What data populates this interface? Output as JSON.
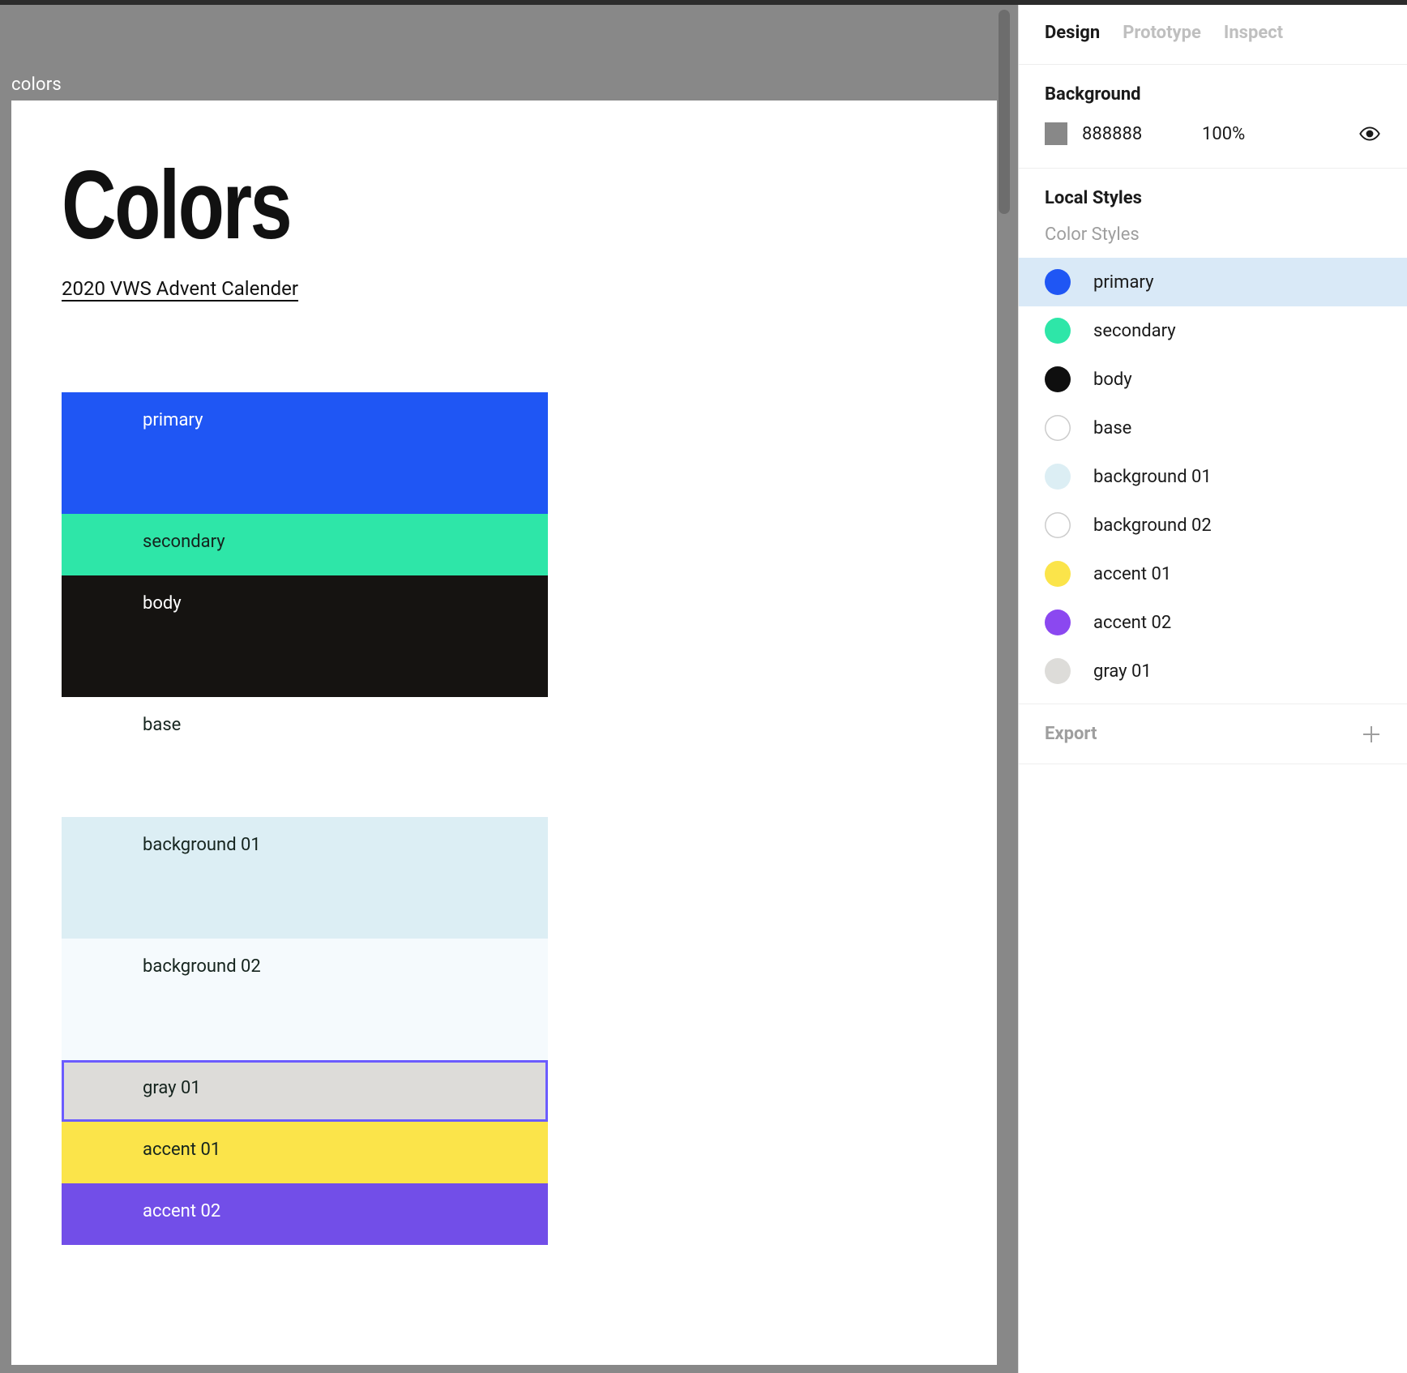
{
  "canvas": {
    "frame_label": "colors",
    "page_title": "Colors",
    "page_subtitle": "2020 VWS Advent Calender",
    "swatches": [
      {
        "label": "primary",
        "bg": "#1f56f4",
        "fg": "#ffffff",
        "size": "h-lg",
        "selected": false
      },
      {
        "label": "secondary",
        "bg": "#2ee6a8",
        "fg": "#15241e",
        "size": "h-md",
        "selected": false
      },
      {
        "label": "body",
        "bg": "#151311",
        "fg": "#ffffff",
        "size": "h-lg",
        "selected": false
      },
      {
        "label": "base",
        "bg": "#ffffff",
        "fg": "#15241e",
        "size": "h-md",
        "selected": false,
        "gap_after": true
      },
      {
        "label": "background 01",
        "bg": "#dceef4",
        "fg": "#15241e",
        "size": "h-bg",
        "selected": false
      },
      {
        "label": "background 02",
        "bg": "#f5fafd",
        "fg": "#15241e",
        "size": "h-bg",
        "selected": false
      },
      {
        "label": "gray 01",
        "bg": "#dddcd9",
        "fg": "#15241e",
        "size": "h-md",
        "selected": true
      },
      {
        "label": "accent 01",
        "bg": "#fbe44a",
        "fg": "#15241e",
        "size": "h-md",
        "selected": false
      },
      {
        "label": "accent 02",
        "bg": "#724ee8",
        "fg": "#ffffff",
        "size": "h-md",
        "selected": false
      }
    ]
  },
  "panel": {
    "tabs": [
      {
        "label": "Design",
        "active": true
      },
      {
        "label": "Prototype",
        "active": false
      },
      {
        "label": "Inspect",
        "active": false
      }
    ],
    "background": {
      "title": "Background",
      "hex": "888888",
      "opacity": "100%",
      "chip_color": "#888888"
    },
    "local_styles": {
      "title": "Local Styles",
      "sub": "Color Styles",
      "items": [
        {
          "label": "primary",
          "color": "#1f56f4",
          "outline": false,
          "selected": true
        },
        {
          "label": "secondary",
          "color": "#2ee6a8",
          "outline": false,
          "selected": false
        },
        {
          "label": "body",
          "color": "#0f0f0f",
          "outline": false,
          "selected": false
        },
        {
          "label": "base",
          "color": "#ffffff",
          "outline": true,
          "selected": false
        },
        {
          "label": "background 01",
          "color": "#dceef4",
          "outline": false,
          "selected": false
        },
        {
          "label": "background 02",
          "color": "#ffffff",
          "outline": true,
          "selected": false
        },
        {
          "label": "accent 01",
          "color": "#fbe44a",
          "outline": false,
          "selected": false
        },
        {
          "label": "accent 02",
          "color": "#8b48f0",
          "outline": false,
          "selected": false
        },
        {
          "label": "gray 01",
          "color": "#dddcd9",
          "outline": false,
          "selected": false
        }
      ]
    },
    "export": {
      "label": "Export"
    }
  }
}
